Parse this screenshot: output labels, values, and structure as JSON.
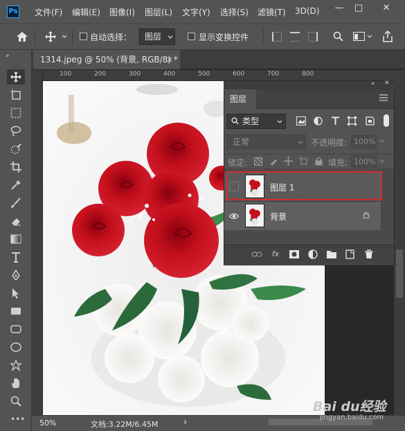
{
  "app": {
    "logo_text": "Ps"
  },
  "menu": [
    {
      "label": "文件(F)"
    },
    {
      "label": "编辑(E)"
    },
    {
      "label": "图像(I)"
    },
    {
      "label": "图层(L)"
    },
    {
      "label": "文字(Y)"
    },
    {
      "label": "选择(S)"
    },
    {
      "label": "滤镜(T)"
    },
    {
      "label": "3D(D)"
    }
  ],
  "window_controls": {
    "minimize": "—",
    "maximize": "□",
    "close": "✕"
  },
  "options_bar": {
    "auto_select_label": "自动选择：",
    "auto_select_target": "图层",
    "show_transform_label": "显示变换控件"
  },
  "document": {
    "tab_title": "1314.jpeg @ 50% (背景, RGB/8) *",
    "tab_close": "×"
  },
  "rulers": {
    "h_ticks": [
      "100",
      "200",
      "300",
      "400",
      "500",
      "600",
      "700",
      "800"
    ]
  },
  "layers_panel": {
    "title": "图层",
    "filter_kind": "类型",
    "blend_mode": "正常",
    "opacity_label": "不透明度:",
    "opacity_value": "100%",
    "lock_label": "锁定:",
    "fill_label": "填充:",
    "fill_value": "100%",
    "layers": [
      {
        "name": "图层 1",
        "visible": false,
        "selected": true
      },
      {
        "name": "背景",
        "visible": true,
        "locked": true
      }
    ],
    "bottom_icons": [
      "link-icon",
      "fx-icon",
      "mask-icon",
      "adjustment-icon",
      "group-folder-icon",
      "new-layer-icon",
      "trash-icon"
    ],
    "fx_text": "fx"
  },
  "status": {
    "zoom": "50%",
    "doc_info": "文档:3.22M/6.45M",
    "nav_arrow": "›"
  },
  "watermark": {
    "logo": "Bai du经验",
    "url": "jingyan.baidu.com"
  },
  "colors": {
    "highlight_red": "#d42b2b",
    "rose_red": "#c4101c",
    "panel_gray": "#535353"
  }
}
